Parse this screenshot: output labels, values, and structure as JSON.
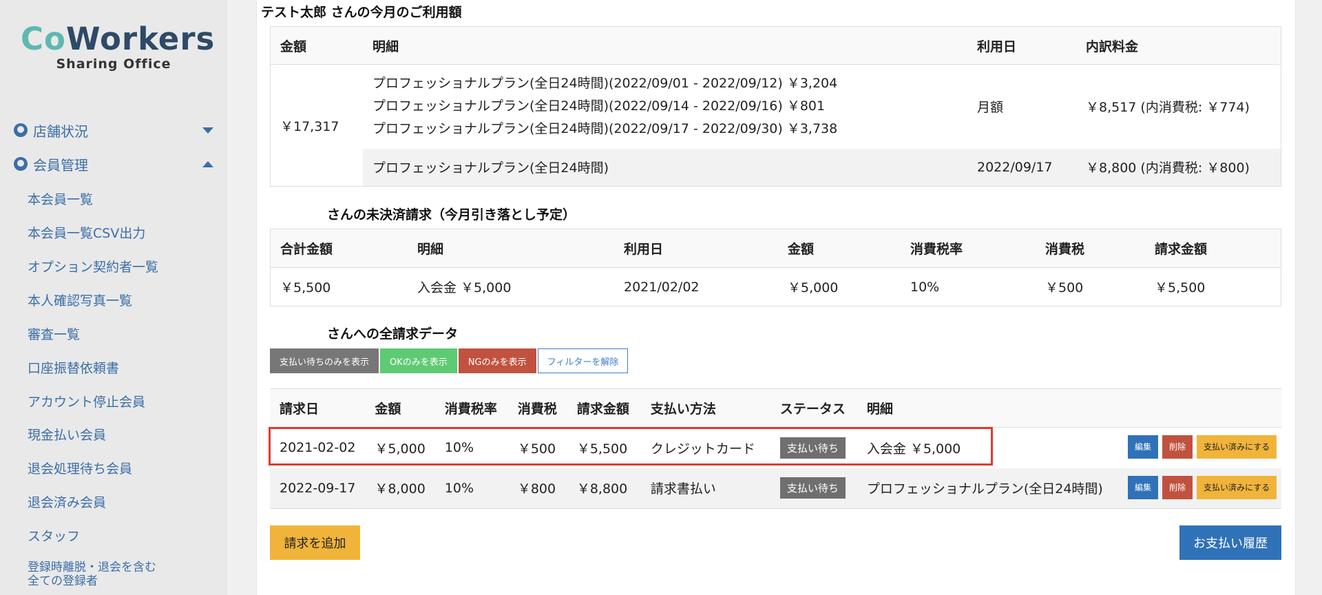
{
  "brand": {
    "logo_co": "Co",
    "logo_workers": "Workers",
    "logo_sub": "Sharing Office"
  },
  "sidebar": {
    "groups": [
      {
        "label": "店舗状況",
        "icon": "dashboard-icon",
        "state": "collapsed"
      },
      {
        "label": "会員管理",
        "icon": "user-circle-icon",
        "state": "expanded"
      }
    ],
    "items": [
      "本会員一覧",
      "本会員一覧CSV出力",
      "オプション契約者一覧",
      "本人確認写真一覧",
      "審査一覧",
      "口座振替依頼書",
      "アカウント停止会員",
      "現金払い会員",
      "退会処理待ち会員",
      "退会済み会員",
      "スタッフ"
    ],
    "last_item_line1": "登録時離脱・退会を含む",
    "last_item_line2": "全ての登録者"
  },
  "usage": {
    "heading": "テスト太郎 さんの今月のご利用額",
    "headers": [
      "金額",
      "明細",
      "利用日",
      "内訳料金"
    ],
    "total": "￥17,317",
    "lines": [
      "プロフェッショナルプラン(全日24時間)(2022/09/01 - 2022/09/12) ￥3,204",
      "プロフェッショナルプラン(全日24時間)(2022/09/14 - 2022/09/16) ￥801",
      "プロフェッショナルプラン(全日24時間)(2022/09/17 - 2022/09/30) ￥3,738"
    ],
    "row1_date": "月額",
    "row1_fee": "￥8,517 (内消費税: ￥774)",
    "row2_detail": "プロフェッショナルプラン(全日24時間)",
    "row2_date": "2022/09/17",
    "row2_fee": "￥8,800 (内消費税: ￥800)"
  },
  "unpaid": {
    "heading": "さんの未決済請求（今月引き落とし予定）",
    "headers": [
      "合計金額",
      "明細",
      "利用日",
      "金額",
      "消費税率",
      "消費税",
      "請求金額"
    ],
    "row": [
      "￥5,500",
      "入会金 ￥5,000",
      "2021/02/02",
      "￥5,000",
      "10%",
      "￥500",
      "￥5,500"
    ]
  },
  "invoices": {
    "heading": "さんへの全請求データ",
    "filters": [
      "支払い待ちのみを表示",
      "OKのみを表示",
      "NGのみを表示",
      "フィルターを解除"
    ],
    "headers": [
      "請求日",
      "金額",
      "消費税率",
      "消費税",
      "請求金額",
      "支払い方法",
      "ステータス",
      "明細"
    ],
    "rows": [
      {
        "date": "2021-02-02",
        "amount": "￥5,000",
        "rate": "10%",
        "tax": "￥500",
        "total": "￥5,500",
        "method": "クレジットカード",
        "status": "支払い待ち",
        "detail": "入会金 ￥5,000"
      },
      {
        "date": "2022-09-17",
        "amount": "￥8,000",
        "rate": "10%",
        "tax": "￥800",
        "total": "￥8,800",
        "method": "請求書払い",
        "status": "支払い待ち",
        "detail": "プロフェッショナルプラン(全日24時間)"
      }
    ],
    "action_labels": {
      "edit": "編集",
      "delete": "削除",
      "mark_paid": "支払い済みにする"
    }
  },
  "buttons": {
    "add_invoice": "請求を追加",
    "payment_history": "お支払い履歴"
  },
  "colors": {
    "accent_blue": "#2f72b8",
    "warning_yellow": "#f1b43a",
    "danger_red": "#c0523f",
    "ok_green": "#5fca74",
    "highlight_red": "#e03b2d"
  }
}
